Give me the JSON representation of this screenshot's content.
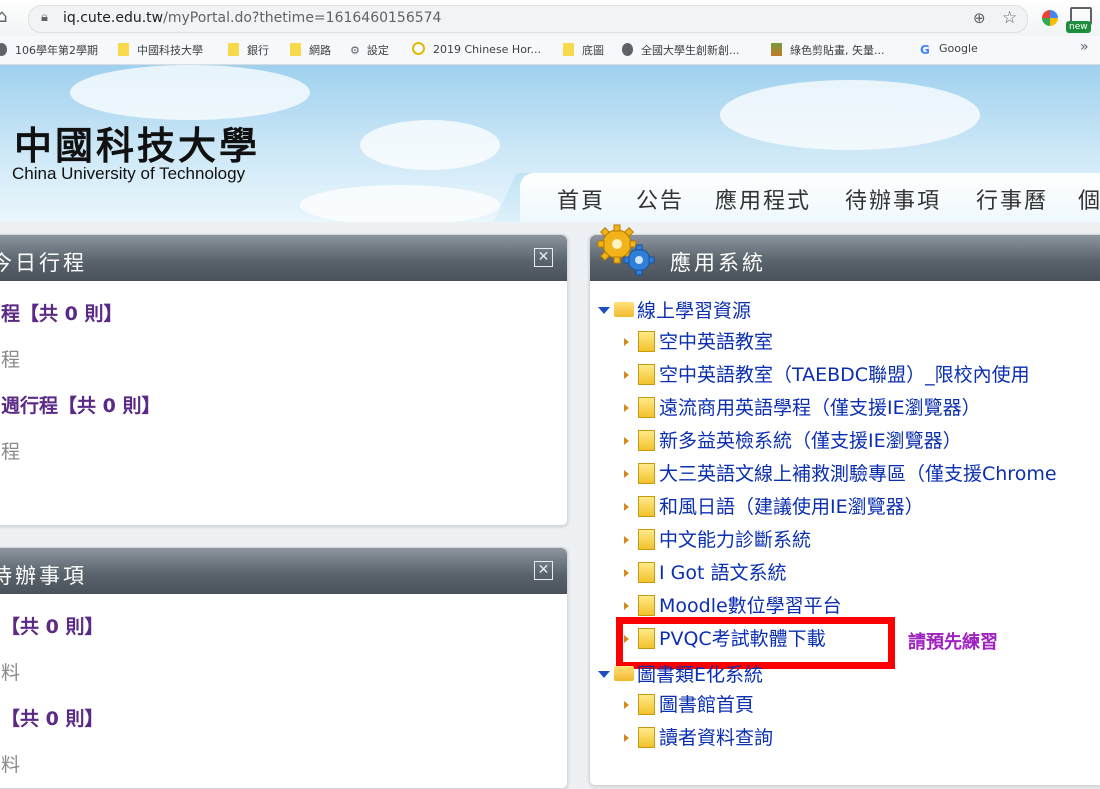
{
  "browser": {
    "url_prefix": "iq.cute.edu.tw",
    "url_path": "/myPortal.do?thetime=1616460156574",
    "extension_badge": "new",
    "bookmarks": [
      {
        "label": "106學年第2學期",
        "icon": "globe-icon"
      },
      {
        "label": "中國科技大學",
        "icon": "folder-icon"
      },
      {
        "label": "銀行",
        "icon": "folder-icon"
      },
      {
        "label": "網路",
        "icon": "folder-icon"
      },
      {
        "label": "設定",
        "icon": "gear-icon"
      },
      {
        "label": "2019 Chinese Hor...",
        "icon": "c-logo-icon"
      },
      {
        "label": "底圖",
        "icon": "folder-icon"
      },
      {
        "label": "全國大學生創新創...",
        "icon": "globe-icon"
      },
      {
        "label": "綠色剪貼畫, 矢量...",
        "icon": "image-icon"
      },
      {
        "label": "Google",
        "icon": "google-icon"
      }
    ],
    "more_symbol": "»"
  },
  "header": {
    "logo_cn": "中國科技大學",
    "logo_en": "China University of Technology",
    "nav": [
      "首頁",
      "公告",
      "應用程式",
      "待辦事項",
      "行事曆",
      "個"
    ]
  },
  "left_panel_top": {
    "title": "今日行程",
    "lines": [
      {
        "text": "程【共 0 則】",
        "style": "heading"
      },
      {
        "text": "程",
        "style": "grey"
      },
      {
        "text": "週行程【共 0 則】",
        "style": "heading"
      },
      {
        "text": "程",
        "style": "grey"
      }
    ]
  },
  "left_panel_bottom": {
    "title": "待辦事項",
    "lines": [
      {
        "text": "【共 0 則】",
        "style": "heading"
      },
      {
        "text": "料",
        "style": "grey"
      },
      {
        "text": "【共 0 則】",
        "style": "heading"
      },
      {
        "text": "料",
        "style": "grey"
      }
    ]
  },
  "app_panel": {
    "title": "應用系統",
    "folder1": "線上學習資源",
    "items1": [
      "空中英語教室",
      "空中英語教室（TAEBDC聯盟）_限校內使用",
      "遠流商用英語學程（僅支援IE瀏覽器）",
      "新多益英檢系統（僅支援IE瀏覽器）",
      "大三英語文線上補救測驗專區（僅支援Chrome",
      "和風日語（建議使用IE瀏覽器）",
      "中文能力診斷系統",
      "I Got 語文系統",
      "Moodle數位學習平台",
      "PVQC考試軟體下載"
    ],
    "note": "請預先練習",
    "folder2": "圖書類E化系統",
    "items2": [
      "圖書館首頁",
      "讀者資料查詢"
    ]
  },
  "colors": {
    "accent_red": "#ff0000",
    "link_blue": "#0b2fb0",
    "note_purple": "#a020c0",
    "heading_purple": "#5b2a86"
  }
}
